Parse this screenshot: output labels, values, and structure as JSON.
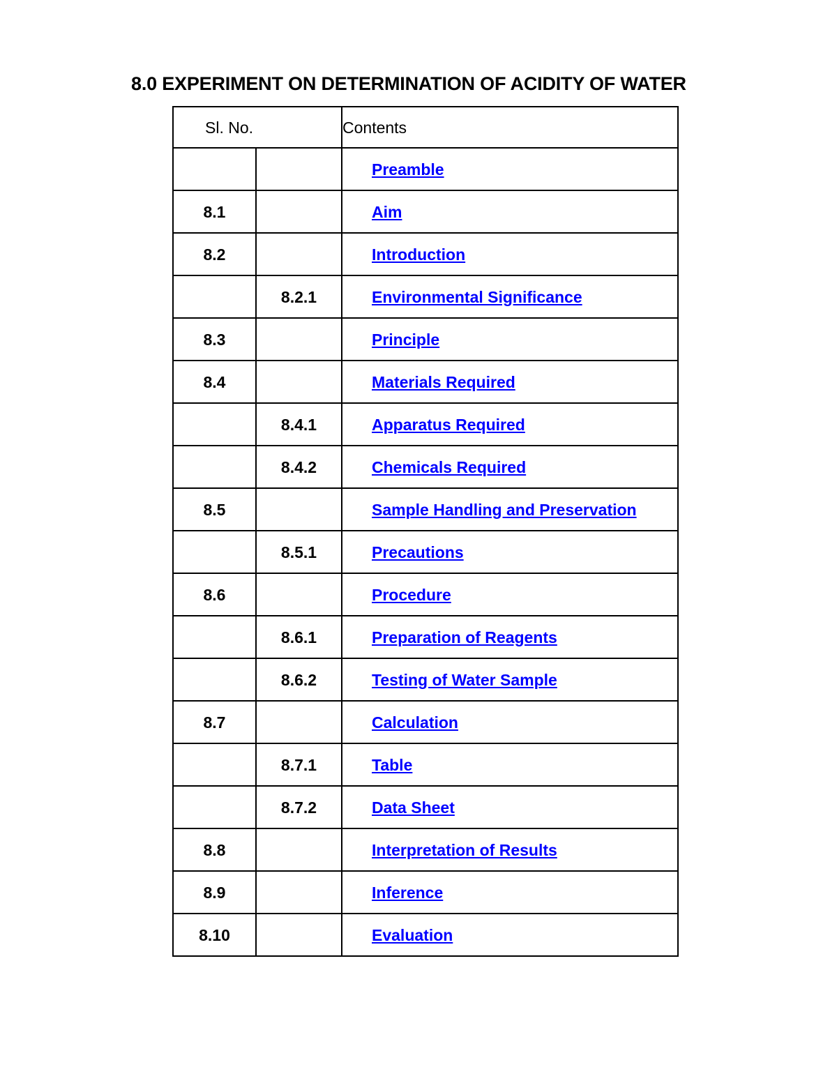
{
  "document": {
    "title": "8.0 EXPERIMENT ON DETERMINATION OF ACIDITY OF WATER",
    "link_color": "#0000FF",
    "text_color": "#000000",
    "border_color": "#000000",
    "background": "#FFFFFF"
  },
  "table": {
    "headers": {
      "sl_no": "Sl. No.",
      "contents": "Contents"
    },
    "rows": [
      {
        "num1": "",
        "num2": "",
        "content": "Preamble"
      },
      {
        "num1": "8.1",
        "num2": "",
        "content": "Aim"
      },
      {
        "num1": "8.2",
        "num2": "",
        "content": "Introduction"
      },
      {
        "num1": "",
        "num2": "8.2.1",
        "content": "Environmental Significance"
      },
      {
        "num1": "8.3",
        "num2": "",
        "content": "Principle"
      },
      {
        "num1": "8.4",
        "num2": "",
        "content": "Materials Required"
      },
      {
        "num1": "",
        "num2": "8.4.1",
        "content": "Apparatus Required"
      },
      {
        "num1": "",
        "num2": "8.4.2",
        "content": "Chemicals Required"
      },
      {
        "num1": "8.5",
        "num2": "",
        "content": "Sample Handling and Preservation"
      },
      {
        "num1": "",
        "num2": "8.5.1",
        "content": "Precautions"
      },
      {
        "num1": "8.6",
        "num2": "",
        "content": "Procedure"
      },
      {
        "num1": "",
        "num2": "8.6.1",
        "content": "Preparation of Reagents"
      },
      {
        "num1": "",
        "num2": "8.6.2",
        "content": "Testing of Water Sample"
      },
      {
        "num1": "8.7",
        "num2": "",
        "content": "Calculation"
      },
      {
        "num1": "",
        "num2": "8.7.1",
        "content": "Table"
      },
      {
        "num1": "",
        "num2": "8.7.2",
        "content": "Data Sheet"
      },
      {
        "num1": "8.8",
        "num2": "",
        "content": "Interpretation of Results"
      },
      {
        "num1": "8.9",
        "num2": "",
        "content": "Inference"
      },
      {
        "num1": "8.10",
        "num2": "",
        "content": "Evaluation"
      }
    ]
  }
}
